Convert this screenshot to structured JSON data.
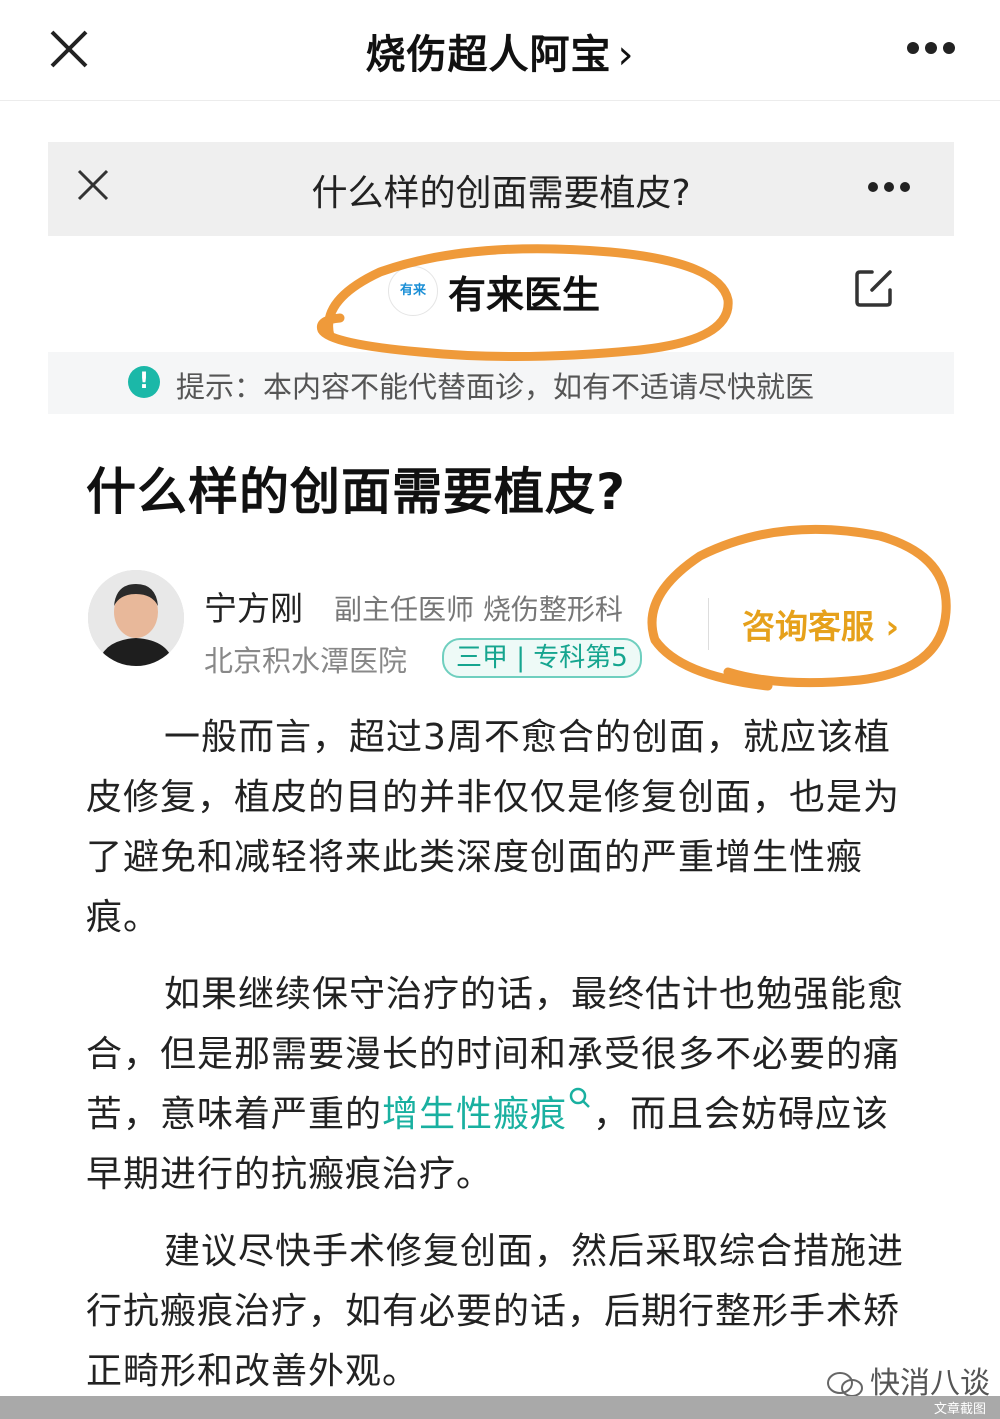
{
  "outer_nav": {
    "title": "烧伤超人阿宝",
    "chevron": "›"
  },
  "inner_nav": {
    "title": "什么样的创面需要植皮?"
  },
  "brand": {
    "logo_text": "有来",
    "name": "有来医生"
  },
  "notice": {
    "icon": "!",
    "text": "提示：本内容不能代替面诊，如有不适请尽快就医"
  },
  "article": {
    "title": "什么样的创面需要植皮?",
    "author": {
      "name": "宁方刚",
      "role": "副主任医师  烧伤整形科",
      "hospital": "北京积水潭医院",
      "badge": "三甲 | 专科第5"
    },
    "consult_label": "咨询客服 ›",
    "paragraphs": [
      "一般而言，超过3周不愈合的创面，就应该植皮修复，植皮的目的并非仅仅是修复创面，也是为了避免和减轻将来此类深度创面的严重增生性瘢痕。",
      "如果继续保守治疗的话，最终估计也勉强能愈合，但是那需要漫长的时间和承受很多不必要的痛苦，意味着严重的",
      "建议尽快手术修复创面，然后采取综合措施进行抗瘢痕治疗，如有必要的话，后期行整形手术矫正畸形和改善外观。"
    ],
    "p2_link": "增生性瘢痕",
    "p2_tail": "，而且会妨碍应该早期进行的抗瘢痕治疗。"
  },
  "watermark": "快消八谈",
  "bottom_label": "文章截图",
  "colors": {
    "accent_teal": "#1bb8a8",
    "consult_orange": "#e6a11b",
    "annotation_orange": "#ef9a3a"
  }
}
